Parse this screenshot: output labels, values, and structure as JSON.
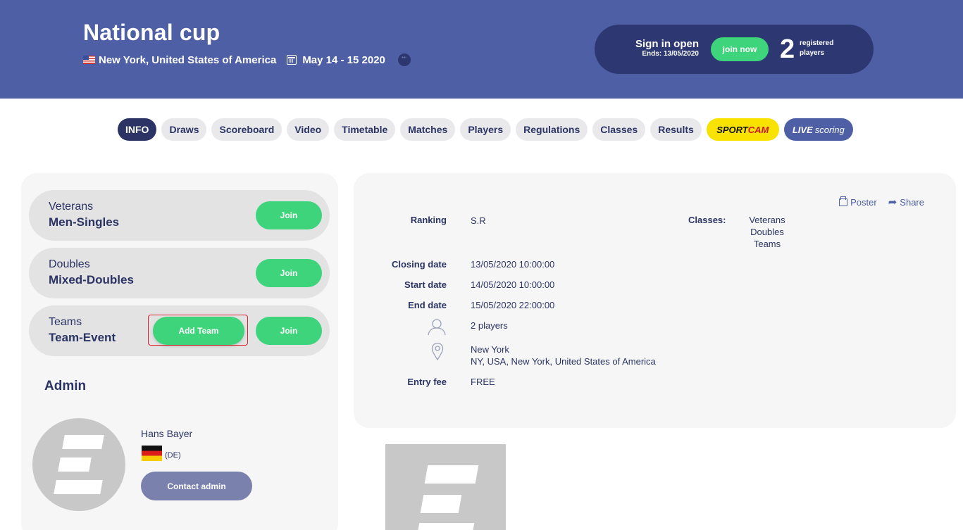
{
  "event": {
    "title": "National cup",
    "location": "New York, United States of America",
    "dates": "May 14 - 15 2020"
  },
  "signup": {
    "status": "Sign in open",
    "ends": "Ends: 13/05/2020",
    "join_label": "join now",
    "registered_count": "2",
    "registered_label_1": "registered",
    "registered_label_2": "players"
  },
  "nav": {
    "tabs": [
      "INFO",
      "Draws",
      "Scoreboard",
      "Video",
      "Timetable",
      "Matches",
      "Players",
      "Regulations",
      "Classes",
      "Results"
    ],
    "active": "INFO",
    "sportcam_1": "SPORT",
    "sportcam_2": "CAM",
    "live_1": "LIVE",
    "live_2": "scoring"
  },
  "classes": [
    {
      "class": "Veterans",
      "event": "Men-Singles",
      "join": "Join"
    },
    {
      "class": "Doubles",
      "event": "Mixed-Doubles",
      "join": "Join"
    },
    {
      "class": "Teams",
      "event": "Team-Event",
      "join": "Join",
      "add_team": "Add Team"
    }
  ],
  "admin": {
    "heading": "Admin",
    "name": "Hans Bayer",
    "country": "(DE)",
    "contact_label": "Contact admin"
  },
  "info": {
    "poster_label": "Poster",
    "share_label": "Share",
    "ranking_label": "Ranking",
    "ranking_value": "S.R",
    "classes_label": "Classes:",
    "classes_values": [
      "Veterans",
      "Doubles",
      "Teams"
    ],
    "closing_label": "Closing date",
    "closing_value": "13/05/2020 10:00:00",
    "start_label": "Start date",
    "start_value": "14/05/2020 10:00:00",
    "end_label": "End date",
    "end_value": "15/05/2020 22:00:00",
    "players_value": "2 players",
    "venue_name": "New York",
    "venue_address": "NY, USA, New York, United States of America",
    "fee_label": "Entry fee",
    "fee_value": "FREE"
  },
  "colors": {
    "header_bg": "#4e5fa6",
    "dark_navy": "#2b3464",
    "green": "#3ed47b",
    "sportcam_yellow": "#f9e200",
    "highlight_red": "#e0202a"
  }
}
